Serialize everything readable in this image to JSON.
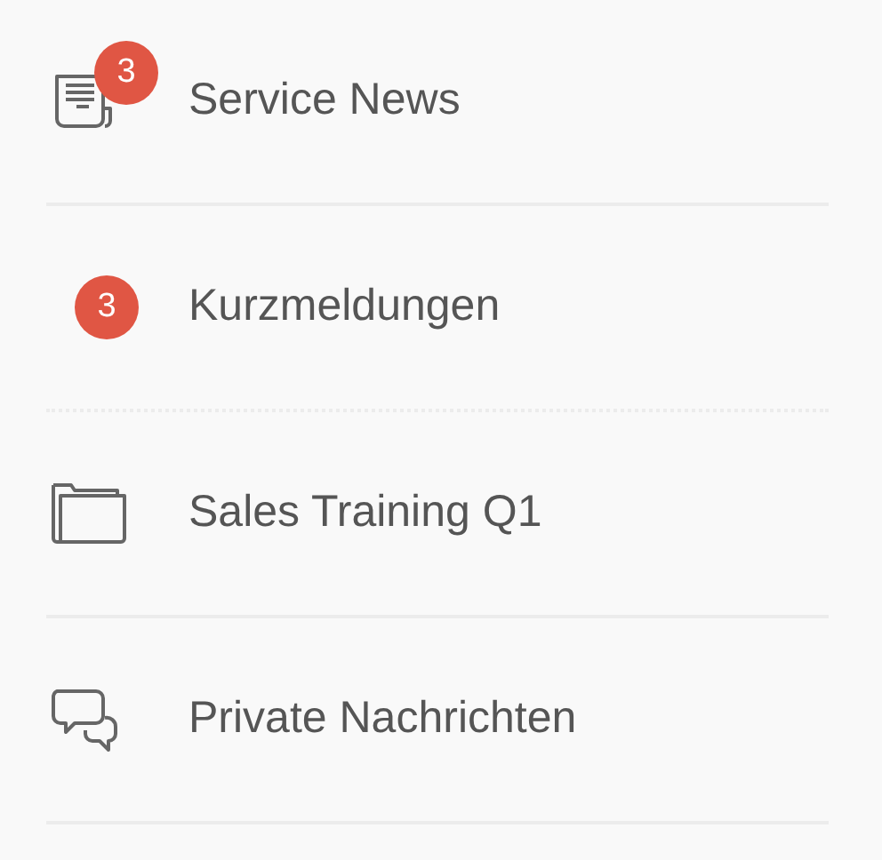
{
  "items": [
    {
      "kind": "news",
      "label": "Service News",
      "badge": "3",
      "dotted_divider": false
    },
    {
      "kind": "plain",
      "label": "Kurzmeldungen",
      "badge": "3",
      "dotted_divider": true
    },
    {
      "kind": "folder",
      "label": "Sales Training Q1",
      "dotted_divider": false
    },
    {
      "kind": "chat",
      "label": "Private Nachrichten",
      "dotted_divider": false
    }
  ]
}
